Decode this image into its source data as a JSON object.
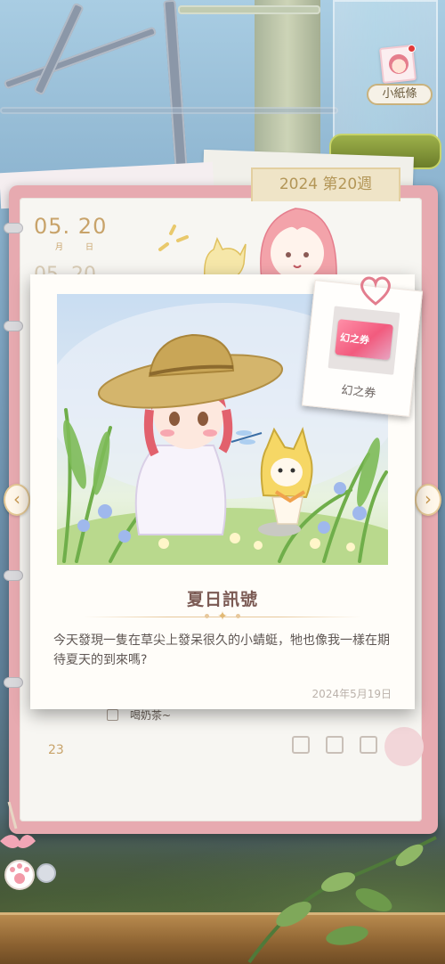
{
  "hud": {
    "notes_label": "小紙條"
  },
  "journal": {
    "week_label": "2024 第20週",
    "date_main": "05. 20",
    "date_month_char": "月",
    "date_day_char": "日",
    "date_ghost": "05. 20",
    "todo_item": "喝奶茶~",
    "page_number": "23"
  },
  "nav": {
    "prev_glyph": "‹",
    "next_glyph": "›"
  },
  "card": {
    "title": "夏日訊號",
    "body": "今天發現一隻在草尖上發呆很久的小蜻蜓，牠也像我一樣在期待夏天的到來嗎?",
    "date": "2024年5月19日",
    "divider_glyph": "✦"
  },
  "reward": {
    "name": "幻之券",
    "ticket_text": "幻之券"
  },
  "colors": {
    "book_pink": "#e7aab0",
    "accent_gold": "#c8a36a",
    "title_brown": "#7b5a54",
    "ticket_pink": "#f25b7e"
  }
}
